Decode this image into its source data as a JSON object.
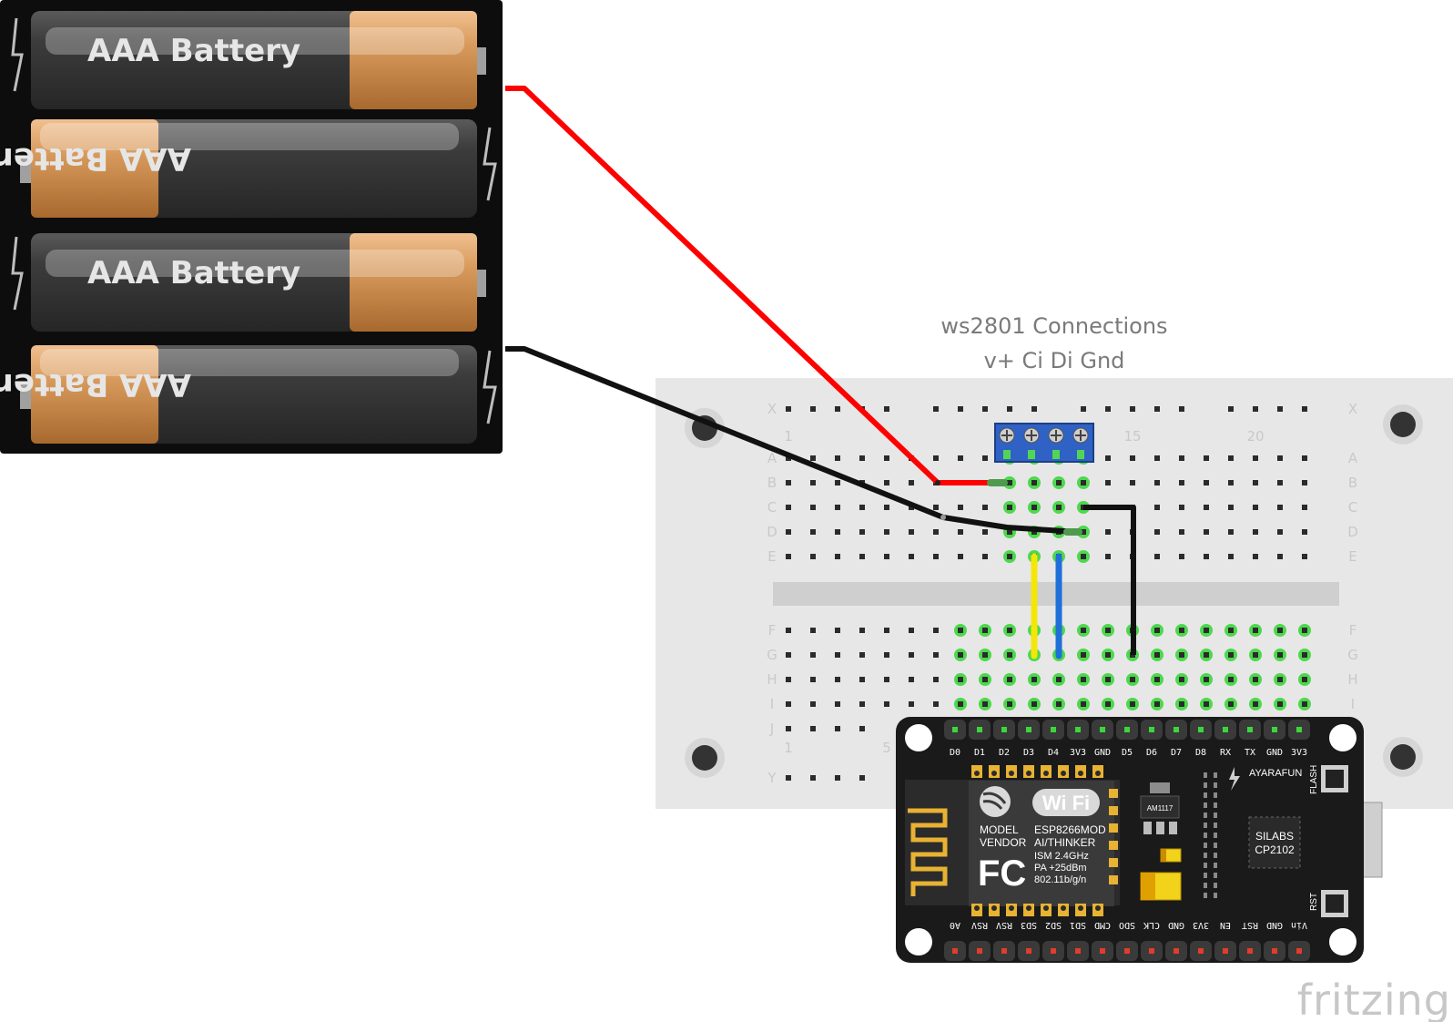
{
  "caption": {
    "line1": "ws2801 Connections",
    "line2": "v+ Ci Di Gnd"
  },
  "batteries": {
    "label": "AAA Battery"
  },
  "breadboard": {
    "rows_top": [
      "X",
      "A",
      "B",
      "C",
      "D",
      "E"
    ],
    "rows_bottom": [
      "F",
      "G",
      "H",
      "I",
      "J",
      "Y"
    ],
    "col_numbers_top": [
      "1",
      "15",
      "20"
    ],
    "col_numbers_bottom": [
      "1",
      "5"
    ]
  },
  "nodemcu": {
    "top_pins": [
      "D0",
      "D1",
      "D2",
      "D3",
      "D4",
      "3V3",
      "GND",
      "D5",
      "D6",
      "D7",
      "D8",
      "RX",
      "TX",
      "GND",
      "3V3"
    ],
    "bottom_pins": [
      "A0",
      "RSV",
      "RSV",
      "SD3",
      "SD2",
      "SD1",
      "CMD",
      "SDO",
      "CLK",
      "GND",
      "3V3",
      "EN",
      "RST",
      "GND",
      "Vin"
    ],
    "brand": "AYARAFUN",
    "flash_label": "FLASH",
    "rst_label": "RST",
    "module": {
      "wifi": "Wi Fi",
      "model_label": "MODEL",
      "vendor_label": "VENDOR",
      "model": "ESP8266MOD",
      "vendor": "AI/THINKER",
      "ism": "ISM 2.4GHz",
      "pa": "PA +25dBm",
      "std": "802.11b/g/n",
      "fcc": "FC"
    },
    "regulator": "AM1117",
    "usb_chip": {
      "line1": "SILABS",
      "line2": "CP2102"
    }
  },
  "watermark": "fritzing",
  "colors": {
    "wire_red": "#ff0000",
    "wire_black": "#111111",
    "wire_yellow": "#f5e60a",
    "wire_blue": "#1e6fd9",
    "terminal_blue": "#2f62c4",
    "board_black": "#1a1a1a",
    "breadboard": "#e7e7e7",
    "highlight_green": "#3cd63c"
  }
}
